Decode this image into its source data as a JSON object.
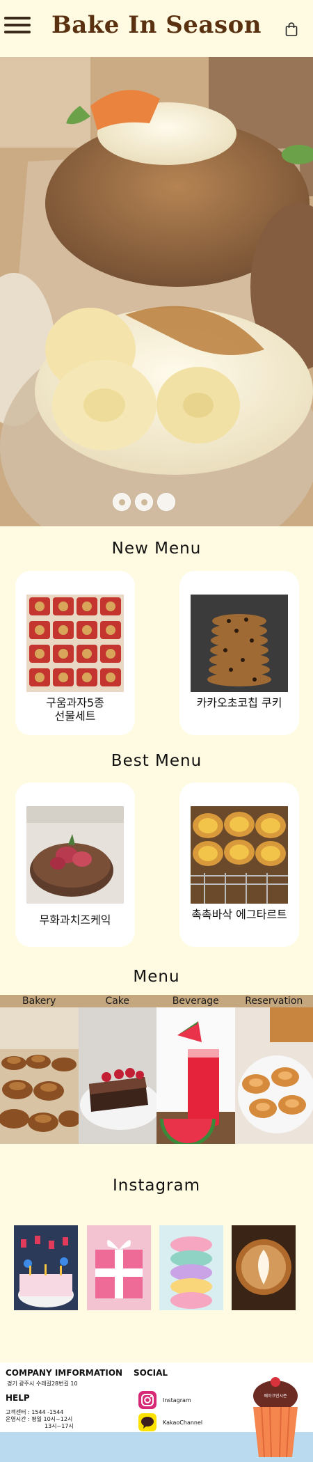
{
  "header": {
    "brand": "Bake In Season",
    "menu_icon": "hamburger-icon",
    "cart_icon": "shopping-bag-icon"
  },
  "hero": {
    "slides": 3,
    "active_slide": 3
  },
  "new_menu": {
    "title": "New Menu",
    "items": [
      {
        "name_line1": "구움과자5종",
        "name_line2": "선물세트"
      },
      {
        "name_line1": "카카오초코칩 쿠키",
        "name_line2": ""
      }
    ]
  },
  "best_menu": {
    "title": "Best Menu",
    "items": [
      {
        "name": "무화과치즈케익"
      },
      {
        "name": "촉촉바삭 에그타르트"
      }
    ]
  },
  "menu": {
    "title": "Menu",
    "tabs": [
      "Bakery",
      "Cake",
      "Beverage",
      "Reservation"
    ]
  },
  "instagram": {
    "title": "Instagram",
    "posts": 4
  },
  "footer": {
    "company_heading": "COMPANY IMFORMATION",
    "address": "경기 광주시 수레길28번길 10",
    "help_heading": "HELP",
    "phone": "고객센터 : 1544 -1544",
    "hours_1": "운영시간 : 평일 10시~12시",
    "hours_2": "13시~17시",
    "social_heading": "SOCIAL",
    "social": [
      {
        "icon": "instagram-icon",
        "label": "Instagram"
      },
      {
        "icon": "kakaotalk-icon",
        "label": "KakaoChannel"
      }
    ],
    "mascot_label": "베이크인시즌"
  },
  "colors": {
    "background": "#fffbe2",
    "brand": "#5a3110",
    "menu_bar": "#c5a77f",
    "footer_strip": "#b9daef"
  }
}
